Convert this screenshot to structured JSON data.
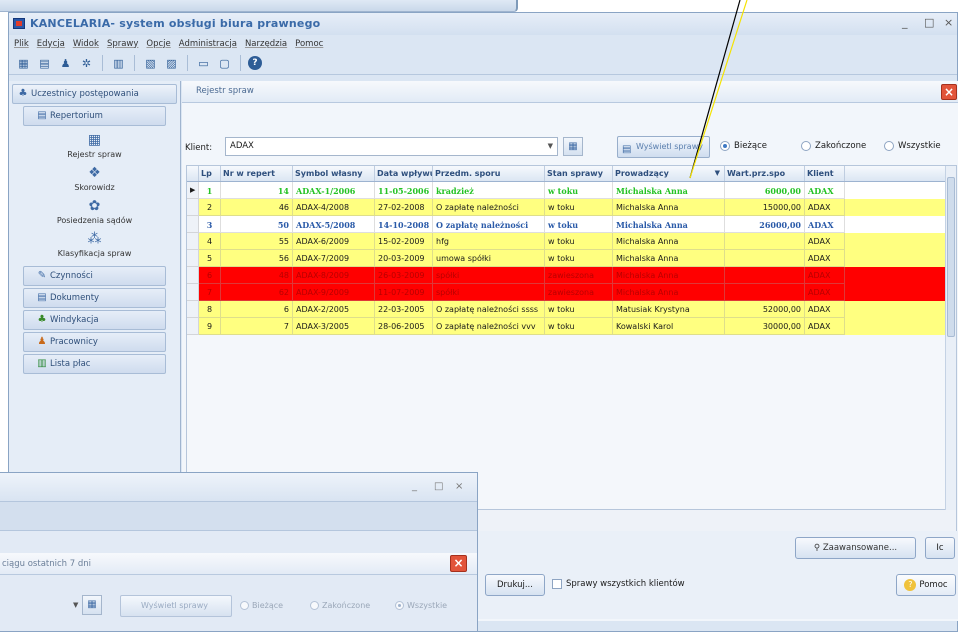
{
  "window": {
    "title": "KANCELARIA- system obsługi biura prawnego",
    "minimize": "_",
    "maximize": "□",
    "close": "×"
  },
  "menu": [
    "Plik",
    "Edycja",
    "Widok",
    "Sprawy",
    "Opcje",
    "Administracja",
    "Narzędzia",
    "Pomoc"
  ],
  "toolbar_icons": [
    "save-icon",
    "archive-icon",
    "users-icon",
    "gears-icon",
    "document-icon",
    "print-icon",
    "calendar-icon",
    "monitor-icon",
    "image-icon",
    "help-icon"
  ],
  "sidebar": {
    "header": "Uczestnicy postępowania",
    "repertorium": "Repertorium",
    "big_items": [
      {
        "label": "Rejestr spraw",
        "icon": "register-icon"
      },
      {
        "label": "Skorowidz",
        "icon": "index-icon"
      },
      {
        "label": "Posiedzenia sądów",
        "icon": "court-icon"
      },
      {
        "label": "Klasyfikacja spraw",
        "icon": "classification-icon"
      }
    ],
    "items": [
      {
        "label": "Czynności",
        "icon": "activity-icon"
      },
      {
        "label": "Dokumenty",
        "icon": "documents-icon"
      },
      {
        "label": "Windykacja",
        "icon": "collection-icon"
      },
      {
        "label": "Pracownicy",
        "icon": "employees-icon"
      },
      {
        "label": "Lista płac",
        "icon": "payroll-icon"
      }
    ]
  },
  "panel": {
    "title": "Rejestr spraw",
    "close": "×"
  },
  "filter": {
    "label": "Klient:",
    "value": "ADAX",
    "show_button": "Wyświetl sprawy",
    "radio_current": "Bieżące",
    "radio_finished": "Zakończone",
    "radio_all": "Wszystkie",
    "selected": "current"
  },
  "table": {
    "columns": [
      "Lp",
      "Nr w repert",
      "Symbol własny",
      "Data wpływu",
      "Przedm. sporu",
      "Stan sprawy",
      "Prowadzący",
      "Wart.prz.spo",
      "Klient"
    ],
    "rows": [
      {
        "lp": "1",
        "nr": "14",
        "symbol": "ADAX-1/2006",
        "data": "11-05-2006",
        "przedmiot": "kradzież",
        "stan": "w toku",
        "prowadzacy": "Michalska Anna",
        "wartosc": "6000,00",
        "klient": "ADAX",
        "style": "selected"
      },
      {
        "lp": "2",
        "nr": "46",
        "symbol": "ADAX-4/2008",
        "data": "27-02-2008",
        "przedmiot": "O zapłatę należności",
        "stan": "w toku",
        "prowadzacy": "Michalska Anna",
        "wartosc": "15000,00",
        "klient": "ADAX",
        "style": "yellow"
      },
      {
        "lp": "3",
        "nr": "50",
        "symbol": "ADAX-5/2008",
        "data": "14-10-2008",
        "przedmiot": "O zapłatę należności",
        "stan": "w toku",
        "prowadzacy": "Michalska Anna",
        "wartosc": "26000,00",
        "klient": "ADAX",
        "style": "white-bold"
      },
      {
        "lp": "4",
        "nr": "55",
        "symbol": "ADAX-6/2009",
        "data": "15-02-2009",
        "przedmiot": "hfg",
        "stan": "w toku",
        "prowadzacy": "Michalska Anna",
        "wartosc": "",
        "klient": "ADAX",
        "style": "yellow"
      },
      {
        "lp": "5",
        "nr": "56",
        "symbol": "ADAX-7/2009",
        "data": "20-03-2009",
        "przedmiot": "umowa spółki",
        "stan": "w toku",
        "prowadzacy": "Michalska Anna",
        "wartosc": "",
        "klient": "ADAX",
        "style": "yellow"
      },
      {
        "lp": "6",
        "nr": "48",
        "symbol": "ADAX-8/2009",
        "data": "26-03-2009",
        "przedmiot": "spółki",
        "stan": "zawieszona",
        "prowadzacy": "Michalska Anna",
        "wartosc": "",
        "klient": "ADAX",
        "style": "red"
      },
      {
        "lp": "7",
        "nr": "62",
        "symbol": "ADAX-9/2009",
        "data": "11-07-2009",
        "przedmiot": "spółki",
        "stan": "zawieszona",
        "prowadzacy": "Michalska Anna",
        "wartosc": "",
        "klient": "ADAX",
        "style": "red"
      },
      {
        "lp": "8",
        "nr": "6",
        "symbol": "ADAX-2/2005",
        "data": "22-03-2005",
        "przedmiot": "O zapłatę należności ssss",
        "stan": "w toku",
        "prowadzacy": "Matusiak Krystyna",
        "wartosc": "52000,00",
        "klient": "ADAX",
        "style": "yellow"
      },
      {
        "lp": "9",
        "nr": "7",
        "symbol": "ADAX-3/2005",
        "data": "28-06-2005",
        "przedmiot": "O zapłatę należności vvv",
        "stan": "w toku",
        "prowadzacy": "Kowalski Karol",
        "wartosc": "30000,00",
        "klient": "ADAX",
        "style": "yellow"
      }
    ]
  },
  "bottom": {
    "advanced_button": "Zaawansowane...",
    "ic_button": "Ic",
    "print_button": "Drukuj...",
    "all_clients_checkbox": "Sprawy wszystkich klientów",
    "help_button": "Pomoc"
  },
  "child": {
    "panel_title": "ciągu ostatnich 7 dni",
    "show_button": "Wyświetl sprawy",
    "radio_current": "Bieżące",
    "radio_finished": "Zakończone",
    "radio_all": "Wszystkie",
    "minimize": "_",
    "maximize": "□",
    "close": "×"
  },
  "colors": {
    "row_yellow": "#ffff80",
    "row_red": "#ff0000",
    "row_selected_text": "#25c225",
    "row_bold_text": "#2a5aa8",
    "accent": "#3e6aa4"
  }
}
